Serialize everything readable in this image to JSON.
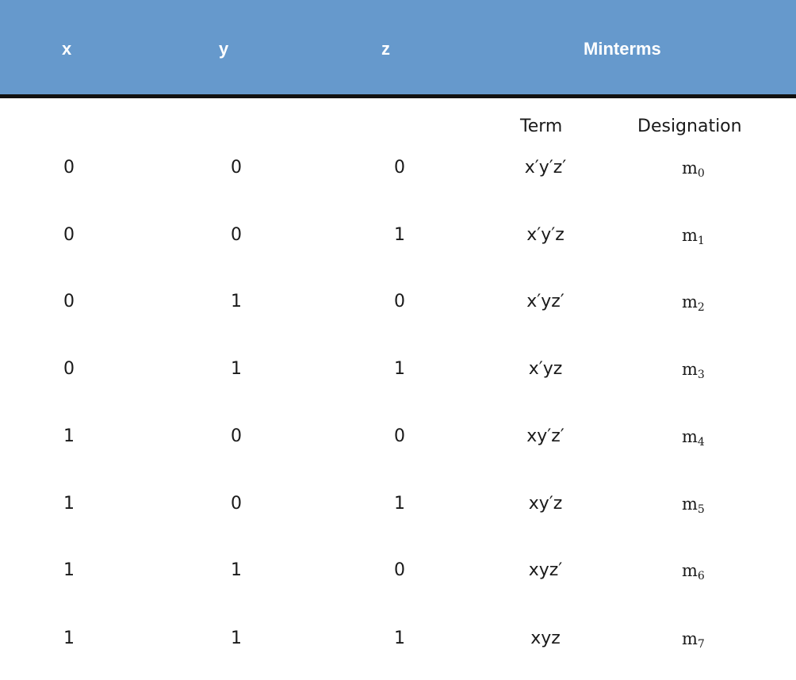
{
  "header": {
    "x": "x",
    "y": "y",
    "z": "z",
    "minterms": "Minterms"
  },
  "subheader": {
    "term": "Term",
    "designation": "Designation"
  },
  "rows": [
    {
      "x": "0",
      "y": "0",
      "z": "0",
      "term": "x′y′z′",
      "m": "m",
      "idx": "0"
    },
    {
      "x": "0",
      "y": "0",
      "z": "1",
      "term": "x′y′z",
      "m": "m",
      "idx": "1"
    },
    {
      "x": "0",
      "y": "1",
      "z": "0",
      "term": "x′yz′",
      "m": "m",
      "idx": "2"
    },
    {
      "x": "0",
      "y": "1",
      "z": "1",
      "term": "x′yz",
      "m": "m",
      "idx": "3"
    },
    {
      "x": "1",
      "y": "0",
      "z": "0",
      "term": "xy′z′",
      "m": "m",
      "idx": "4"
    },
    {
      "x": "1",
      "y": "0",
      "z": "1",
      "term": "xy′z",
      "m": "m",
      "idx": "5"
    },
    {
      "x": "1",
      "y": "1",
      "z": "0",
      "term": "xyz′",
      "m": "m",
      "idx": "6"
    },
    {
      "x": "1",
      "y": "1",
      "z": "1",
      "term": "xyz",
      "m": "m",
      "idx": "7"
    }
  ],
  "colors": {
    "header_bg": "#6699cc",
    "header_text": "#ffffff",
    "rule": "#111111"
  }
}
